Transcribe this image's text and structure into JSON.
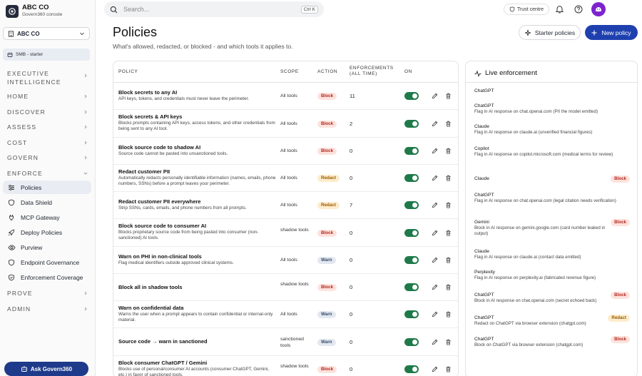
{
  "brand": {
    "name": "ABC CO",
    "subtitle": "Govern360 console"
  },
  "tenant": {
    "name": "ABC CO"
  },
  "plan": {
    "label": "SMB - starter"
  },
  "nav": {
    "executive_intelligence": "EXECUTIVE INTELLIGENCE",
    "home": "HOME",
    "discover": "DISCOVER",
    "assess": "ASSESS",
    "cost": "COST",
    "govern": "GOVERN",
    "enforce": "ENFORCE",
    "enforce_items": [
      {
        "label": "Policies",
        "icon": "sliders-icon",
        "active": true
      },
      {
        "label": "Data Shield",
        "icon": "shield-icon"
      },
      {
        "label": "MCP Gateway",
        "icon": "plug-icon"
      },
      {
        "label": "Deploy Policies",
        "icon": "rocket-icon"
      },
      {
        "label": "Purview",
        "icon": "eye-icon"
      },
      {
        "label": "Endpoint Governance",
        "icon": "shield-icon"
      },
      {
        "label": "Enforcement Coverage",
        "icon": "shield-check-icon"
      }
    ],
    "prove": "PROVE",
    "admin": "ADMIN"
  },
  "ask_button": "Ask Govern360",
  "search": {
    "placeholder": "Search...",
    "shortcut": "Ctrl K"
  },
  "topbar": {
    "trust_centre": "Trust centre"
  },
  "header": {
    "title": "Policies",
    "subtitle": "What's allowed, redacted, or blocked - and which tools it applies to.",
    "starter_button": "Starter policies",
    "new_button": "New policy"
  },
  "table": {
    "columns": {
      "policy": "POLICY",
      "scope": "SCOPE",
      "action": "ACTION",
      "enforcements_line1": "ENFORCEMENTS",
      "enforcements_line2": "(ALL TIME)",
      "on": "ON"
    },
    "rows": [
      {
        "title": "Block secrets to any AI",
        "desc": "API keys, tokens, and credentials must never leave the perimeter.",
        "scope": "All tools",
        "action": "Block",
        "enforcements": "11",
        "on": true
      },
      {
        "title": "Block secrets & API keys",
        "desc": "Blocks prompts containing API keys, access tokens, and other credentials from being sent to any AI tool.",
        "scope": "All tools",
        "action": "Block",
        "enforcements": "2",
        "on": true
      },
      {
        "title": "Block source code to shadow AI",
        "desc": "Source code cannot be pasted into unsanctioned tools.",
        "scope": "All tools",
        "action": "Block",
        "enforcements": "0",
        "on": true
      },
      {
        "title": "Redact customer PII",
        "desc": "Automatically redacts personally identifiable information (names, emails, phone numbers, SSNs) before a prompt leaves your perimeter.",
        "scope": "All tools",
        "action": "Redact",
        "enforcements": "0",
        "on": true
      },
      {
        "title": "Redact customer PII everywhere",
        "desc": "Strip SSNs, cards, emails, and phone numbers from all prompts.",
        "scope": "All tools",
        "action": "Redact",
        "enforcements": "7",
        "on": true
      },
      {
        "title": "Block source code to consumer AI",
        "desc": "Blocks proprietary source code from being pasted into consumer (non-sanctioned) AI tools.",
        "scope": "shadow tools",
        "action": "Block",
        "enforcements": "0",
        "on": true
      },
      {
        "title": "Warn on PHI in non-clinical tools",
        "desc": "Flag medical identifiers outside approved clinical systems.",
        "scope": "All tools",
        "action": "Warn",
        "enforcements": "0",
        "on": true
      },
      {
        "title": "Block all in shadow tools",
        "desc": "",
        "scope": "shadow tools",
        "action": "Block",
        "enforcements": "0",
        "on": true
      },
      {
        "title": "Warn on confidential data",
        "desc": "Warns the user when a prompt appears to contain confidential or internal-only material.",
        "scope": "All tools",
        "action": "Warn",
        "enforcements": "0",
        "on": true
      },
      {
        "title": "Source code → warn in sanctioned",
        "desc": "",
        "scope": "sanctioned tools",
        "action": "Warn",
        "enforcements": "0",
        "on": true
      },
      {
        "title": "Block consumer ChatGPT / Gemini",
        "desc": "Blocks use of personal/consumer AI accounts (consumer ChatGPT, Gemini, etc.) in favor of sanctioned tools.",
        "scope": "shadow tools",
        "action": "Block",
        "enforcements": "0",
        "on": true
      }
    ]
  },
  "live": {
    "title": "Live enforcement",
    "events": [
      {
        "app": "ChatGPT",
        "desc": "",
        "badge": ""
      },
      {
        "app": "ChatGPT",
        "desc": "Flag in AI response on chat.openai.com (PII the model emitted)",
        "badge": ""
      },
      {
        "app": "Claude",
        "desc": "Flag in AI response on claude.ai (unverified financial figures)",
        "badge": ""
      },
      {
        "app": "Copilot",
        "desc": "Flag in AI response on copilot.microsoft.com (medical terms for review)",
        "badge": ""
      },
      {
        "app": "Claude",
        "desc": "",
        "badge": "Block"
      },
      {
        "app": "ChatGPT",
        "desc": "Flag in AI response on chat.openai.com (legal citation needs verification)",
        "badge": ""
      },
      {
        "app": "Gemini",
        "desc": "Block in AI response on gemini.google.com (card number leaked in output)",
        "badge": "Block"
      },
      {
        "app": "Claude",
        "desc": "Flag in AI response on claude.ai (contact data emitted)",
        "badge": ""
      },
      {
        "app": "Perplexity",
        "desc": "Flag in AI response on perplexity.ai (fabricated revenue figure)",
        "badge": ""
      },
      {
        "app": "ChatGPT",
        "desc": "Block in AI response on chat.openai.com (secret echoed back)",
        "badge": "Block"
      },
      {
        "app": "ChatGPT",
        "desc": "Redact on ChatGPT via browser extension (chatgpt.com)",
        "badge": "Redact"
      },
      {
        "app": "ChatGPT",
        "desc": "Block on ChatGPT via browser extension (chatgpt.com)",
        "badge": "Block"
      }
    ]
  },
  "colors": {
    "primary": "#1e40af",
    "toggle_on": "#1f7a4a",
    "block_bg": "#fde2dd",
    "redact_bg": "#fdeccc",
    "warn_bg": "#e3e8f0",
    "avatar": "#7e22ce"
  }
}
